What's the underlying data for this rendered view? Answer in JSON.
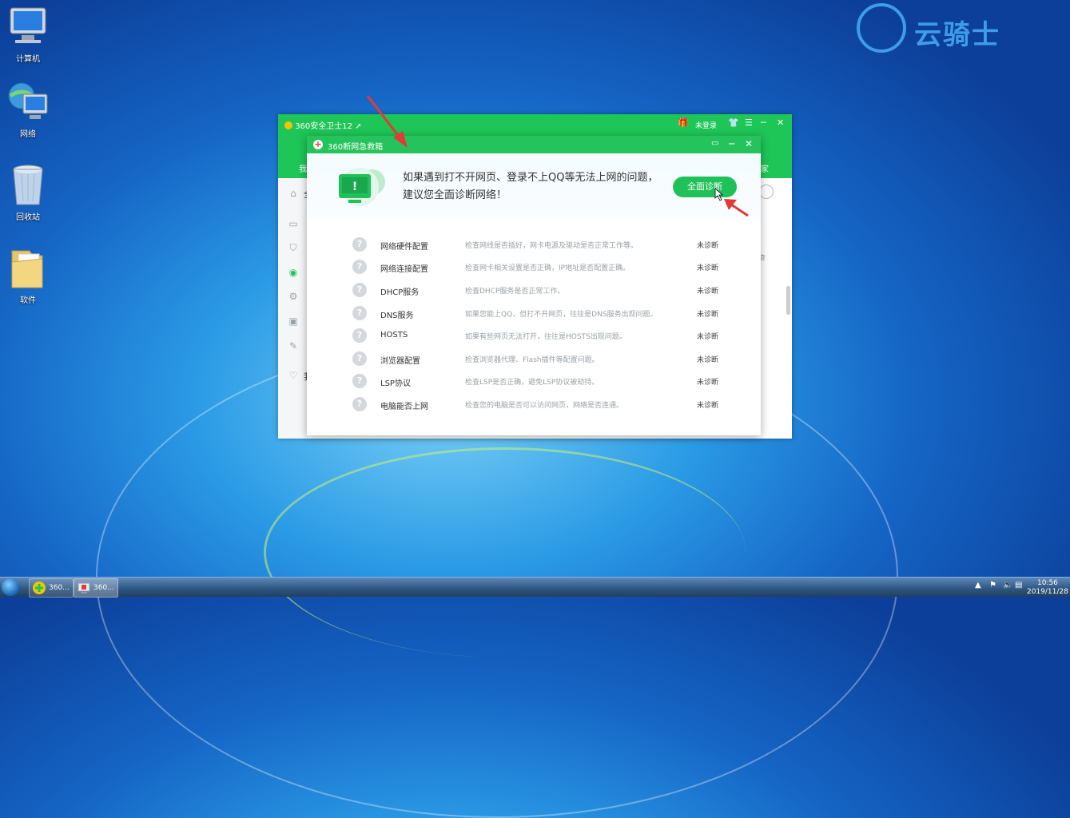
{
  "desktop": {
    "icons": [
      {
        "label": "计算机",
        "icon": "computer-icon"
      },
      {
        "label": "网络",
        "icon": "network-icon"
      },
      {
        "label": "回收站",
        "icon": "recycle-bin-icon"
      },
      {
        "label": "软件",
        "icon": "folder-icon"
      }
    ],
    "watermark": "云骑士"
  },
  "main_window": {
    "title": "360安全卫士12",
    "login_label": "未登录",
    "peek_left_tab": "我",
    "peek_right_tab": "家",
    "peek_side_text": "全",
    "peek_side_text2": "我",
    "peek_right_text": "查"
  },
  "dialog": {
    "title": "360断网急救箱",
    "message_line1": "如果遇到打不开网页、登录不上QQ等无法上网的问题，",
    "message_line2": "建议您全面诊断网络！",
    "diagnose_button": "全面诊断",
    "items": [
      {
        "name": "网络硬件配置",
        "desc": "检查网线是否插好，网卡电源及驱动是否正常工作等。",
        "status": "未诊断"
      },
      {
        "name": "网络连接配置",
        "desc": "检查网卡相关设置是否正确，IP地址是否配置正确。",
        "status": "未诊断"
      },
      {
        "name": "DHCP服务",
        "desc": "检查DHCP服务是否正常工作。",
        "status": "未诊断"
      },
      {
        "name": "DNS服务",
        "desc": "如果您能上QQ，但打不开网页，往往是DNS服务出现问题。",
        "status": "未诊断"
      },
      {
        "name": "HOSTS",
        "desc": "如果有些网页无法打开，往往是HOSTS出现问题。",
        "status": "未诊断"
      },
      {
        "name": "浏览器配置",
        "desc": "检查浏览器代理、Flash插件等配置问题。",
        "status": "未诊断"
      },
      {
        "name": "LSP协议",
        "desc": "检查LSP是否正确，避免LSP协议被劫持。",
        "status": "未诊断"
      },
      {
        "name": "电脑能否上网",
        "desc": "检查您的电脑是否可以访问网页，网络是否连通。",
        "status": "未诊断"
      }
    ]
  },
  "taskbar": {
    "buttons": [
      {
        "label": "360...",
        "icon": "360-safeguard-icon"
      },
      {
        "label": "360...",
        "icon": "network-rescue-icon"
      }
    ],
    "time": "10:56",
    "date": "2019/11/28"
  },
  "colors": {
    "accent": "#1ec557",
    "button": "#21c15a",
    "annotation_arrow": "#e53935"
  }
}
